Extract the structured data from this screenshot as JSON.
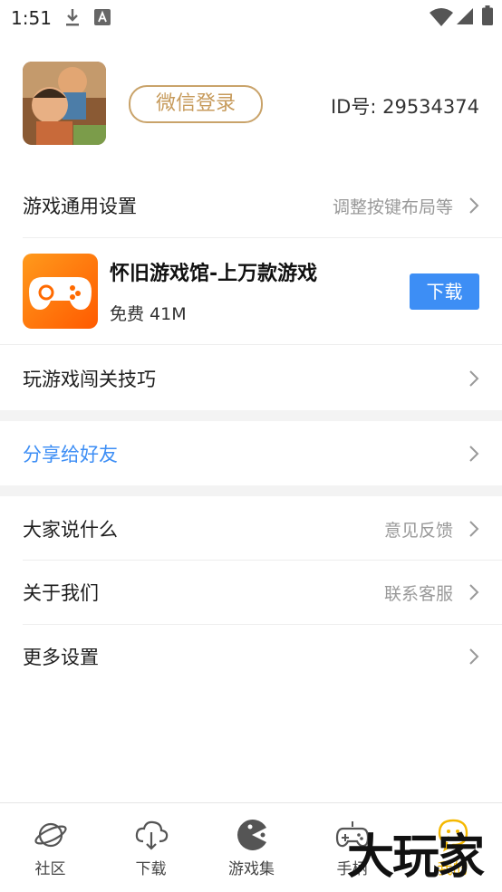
{
  "status": {
    "time": "1:51"
  },
  "profile": {
    "login_label": "微信登录",
    "id_text": "ID号: 29534374"
  },
  "menu": {
    "general_settings": {
      "label": "游戏通用设置",
      "hint": "调整按键布局等"
    },
    "tips": {
      "label": "玩游戏闯关技巧"
    },
    "share": {
      "label": "分享给好友"
    },
    "feedback": {
      "label": "大家说什么",
      "hint": "意见反馈"
    },
    "about": {
      "label": "关于我们",
      "hint": "联系客服"
    },
    "more": {
      "label": "更多设置"
    }
  },
  "promo": {
    "title": "怀旧游戏馆-上万款游戏",
    "meta": "免费 41M",
    "button": "下载"
  },
  "tabs": [
    {
      "label": "社区",
      "icon": "planet-icon"
    },
    {
      "label": "下载",
      "icon": "cloud-download-icon"
    },
    {
      "label": "游戏集",
      "icon": "pacman-icon"
    },
    {
      "label": "手柄",
      "icon": "gamepad-icon"
    },
    {
      "label": "我的",
      "icon": "smile-icon"
    }
  ],
  "watermark": {
    "text": "大玩家"
  },
  "colors": {
    "accent_gold": "#c79b5c",
    "link_blue": "#3d8ef5",
    "active_tab": "#f5b800"
  }
}
